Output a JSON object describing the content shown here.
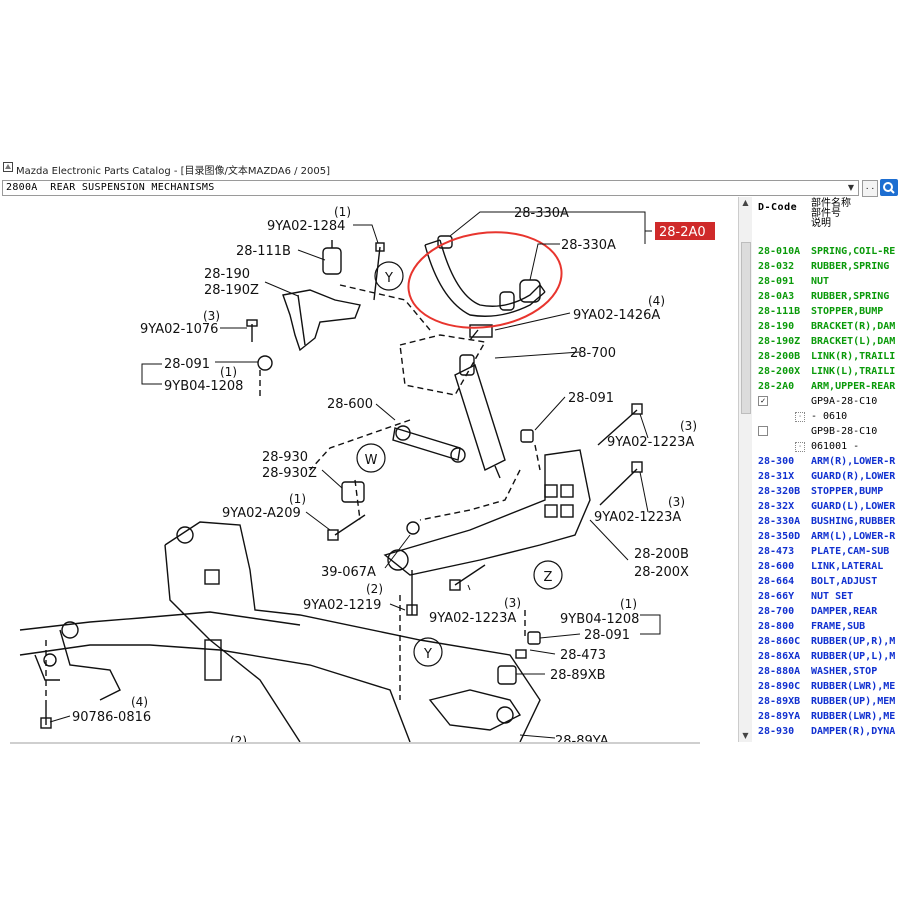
{
  "window": {
    "title": "Mazda Electronic Parts Catalog - [目录图像/文本MAZDA6 / 2005]"
  },
  "toolbar": {
    "path_text": "2800A  REAR SUSPENSION MECHANISMS",
    "dropdown_glyph": "▼",
    "more_label": ". .",
    "view_icon": "search-icon"
  },
  "diagram": {
    "callouts": {
      "c1": "28-330A",
      "c2": "28-330A",
      "c3": "28-2A0",
      "c4": "9YA02-1426A",
      "c4q": "(4)",
      "c5": "9YA02-1284",
      "c5q": "(1)",
      "c6": "28-111B",
      "c7": "28-190",
      "c8": "28-190Z",
      "c9": "9YA02-1076",
      "c9q": "(3)",
      "c10": "28-091",
      "c11": "9YB04-1208",
      "c11q": "(1)",
      "c12": "28-700",
      "c13": "28-600",
      "c14": "28-091",
      "c15": "9YA02-1223A",
      "c15q": "(3)",
      "c16": "28-930",
      "c17": "28-930Z",
      "c18": "9YA02-A209",
      "c18q": "(1)",
      "c19": "39-067A",
      "c20": "9YA02-1223A",
      "c20q": "(3)",
      "c21": "28-200B",
      "c22": "28-200X",
      "c23": "9YA02-1219",
      "c23q": "(2)",
      "c24": "9YA02-1223A",
      "c24q": "(3)",
      "c25": "9YB04-1208",
      "c25q": "(1)",
      "c26": "28-091",
      "c27": "28-473",
      "c28": "28-89XB",
      "c29": "90786-0816",
      "c29q": "(4)",
      "c30": "28-89YA",
      "c31q": "(2)"
    },
    "view_letters": {
      "y1": "Y",
      "w": "W",
      "z": "Z",
      "y2": "Y"
    },
    "highlight_color": "#e8352e",
    "selected_bg": "#cf2a2a"
  },
  "parts_panel": {
    "header_code": "D-Code",
    "header_cols": [
      "部件名称",
      "部件号",
      "说明"
    ],
    "green": "#0a9a0a",
    "blue": "#1030d0",
    "rows": [
      {
        "code": "28-010A",
        "name": "SPRING,COIL-RE",
        "color": "green"
      },
      {
        "code": "28-032",
        "name": "RUBBER,SPRING",
        "color": "green"
      },
      {
        "code": "28-091",
        "name": "NUT",
        "color": "green"
      },
      {
        "code": "28-0A3",
        "name": "RUBBER,SPRING",
        "color": "green"
      },
      {
        "code": "28-111B",
        "name": "STOPPER,BUMP",
        "color": "green"
      },
      {
        "code": "28-190",
        "name": "BRACKET(R),DAM",
        "color": "green"
      },
      {
        "code": "28-190Z",
        "name": "BRACKET(L),DAM",
        "color": "green"
      },
      {
        "code": "28-200B",
        "name": "LINK(R),TRAILI",
        "color": "green"
      },
      {
        "code": "28-200X",
        "name": "LINK(L),TRAILI",
        "color": "green"
      },
      {
        "code": "28-2A0",
        "name": "ARM,UPPER-REAR",
        "color": "green"
      },
      {
        "sub": true,
        "check": "✓",
        "text": "GP9A-28-C10"
      },
      {
        "sub2": true,
        "text": "- 0610"
      },
      {
        "sub": true,
        "check": "",
        "text": "GP9B-28-C10"
      },
      {
        "sub2": true,
        "text": "061001 -"
      },
      {
        "code": "28-300",
        "name": "ARM(R),LOWER-R",
        "color": "blue"
      },
      {
        "code": "28-31X",
        "name": "GUARD(R),LOWER",
        "color": "blue"
      },
      {
        "code": "28-320B",
        "name": "STOPPER,BUMP",
        "color": "blue"
      },
      {
        "code": "28-32X",
        "name": "GUARD(L),LOWER",
        "color": "blue"
      },
      {
        "code": "28-330A",
        "name": "BUSHING,RUBBER",
        "color": "blue"
      },
      {
        "code": "28-350D",
        "name": "ARM(L),LOWER-R",
        "color": "blue"
      },
      {
        "code": "28-473",
        "name": "PLATE,CAM-SUB",
        "color": "blue"
      },
      {
        "code": "28-600",
        "name": "LINK,LATERAL",
        "color": "blue"
      },
      {
        "code": "28-664",
        "name": "BOLT,ADJUST",
        "color": "blue"
      },
      {
        "code": "28-66Y",
        "name": "NUT SET",
        "color": "blue"
      },
      {
        "code": "28-700",
        "name": "DAMPER,REAR",
        "color": "blue"
      },
      {
        "code": "28-800",
        "name": "FRAME,SUB",
        "color": "blue"
      },
      {
        "code": "28-860C",
        "name": "RUBBER(UP,R),M",
        "color": "blue"
      },
      {
        "code": "28-86XA",
        "name": "RUBBER(UP,L),M",
        "color": "blue"
      },
      {
        "code": "28-880A",
        "name": "WASHER,STOP",
        "color": "blue"
      },
      {
        "code": "28-890C",
        "name": "RUBBER(LWR),ME",
        "color": "blue"
      },
      {
        "code": "28-89XB",
        "name": "RUBBER(UP),MEM",
        "color": "blue"
      },
      {
        "code": "28-89YA",
        "name": "RUBBER(LWR),ME",
        "color": "blue"
      },
      {
        "code": "28-930",
        "name": "DAMPER(R),DYNA",
        "color": "blue"
      }
    ]
  }
}
